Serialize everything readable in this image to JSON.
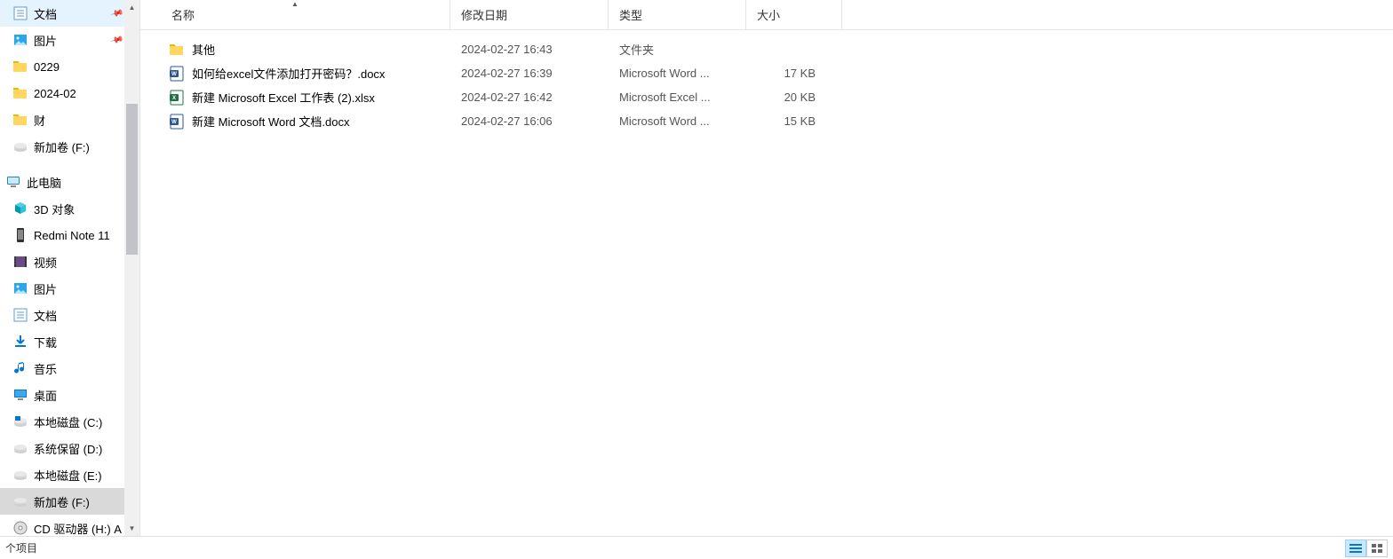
{
  "sidebar": {
    "quick": [
      {
        "label": "文档",
        "icon": "doc-lib",
        "pinned": true
      },
      {
        "label": "图片",
        "icon": "img-lib",
        "pinned": true
      },
      {
        "label": "0229",
        "icon": "folder",
        "pinned": false
      },
      {
        "label": "2024-02",
        "icon": "folder",
        "pinned": false
      },
      {
        "label": "财",
        "icon": "folder",
        "pinned": false
      },
      {
        "label": "新加卷 (F:)",
        "icon": "disk",
        "pinned": false
      }
    ],
    "thispc_label": "此电脑",
    "thispc": [
      {
        "label": "3D 对象",
        "icon": "3d"
      },
      {
        "label": "Redmi Note 11",
        "icon": "phone"
      },
      {
        "label": "视频",
        "icon": "video"
      },
      {
        "label": "图片",
        "icon": "img-lib"
      },
      {
        "label": "文档",
        "icon": "doc-lib"
      },
      {
        "label": "下载",
        "icon": "download"
      },
      {
        "label": "音乐",
        "icon": "music"
      },
      {
        "label": "桌面",
        "icon": "desktop"
      },
      {
        "label": "本地磁盘 (C:)",
        "icon": "disk-c"
      },
      {
        "label": "系统保留 (D:)",
        "icon": "disk"
      },
      {
        "label": "本地磁盘 (E:)",
        "icon": "disk"
      },
      {
        "label": "新加卷 (F:)",
        "icon": "disk",
        "selected": true
      },
      {
        "label": "CD 驱动器 (H:) A",
        "icon": "cd"
      }
    ]
  },
  "columns": {
    "name": "名称",
    "date": "修改日期",
    "type": "类型",
    "size": "大小"
  },
  "files": [
    {
      "name": "其他",
      "date": "2024-02-27 16:43",
      "type": "文件夹",
      "size": "",
      "icon": "folder"
    },
    {
      "name": "如何给excel文件添加打开密码？.docx",
      "date": "2024-02-27 16:39",
      "type": "Microsoft Word ...",
      "size": "17 KB",
      "icon": "docx"
    },
    {
      "name": "新建 Microsoft Excel 工作表 (2).xlsx",
      "date": "2024-02-27 16:42",
      "type": "Microsoft Excel ...",
      "size": "20 KB",
      "icon": "xlsx"
    },
    {
      "name": "新建 Microsoft Word 文档.docx",
      "date": "2024-02-27 16:06",
      "type": "Microsoft Word ...",
      "size": "15 KB",
      "icon": "docx"
    }
  ],
  "status": {
    "items": "个项目"
  }
}
